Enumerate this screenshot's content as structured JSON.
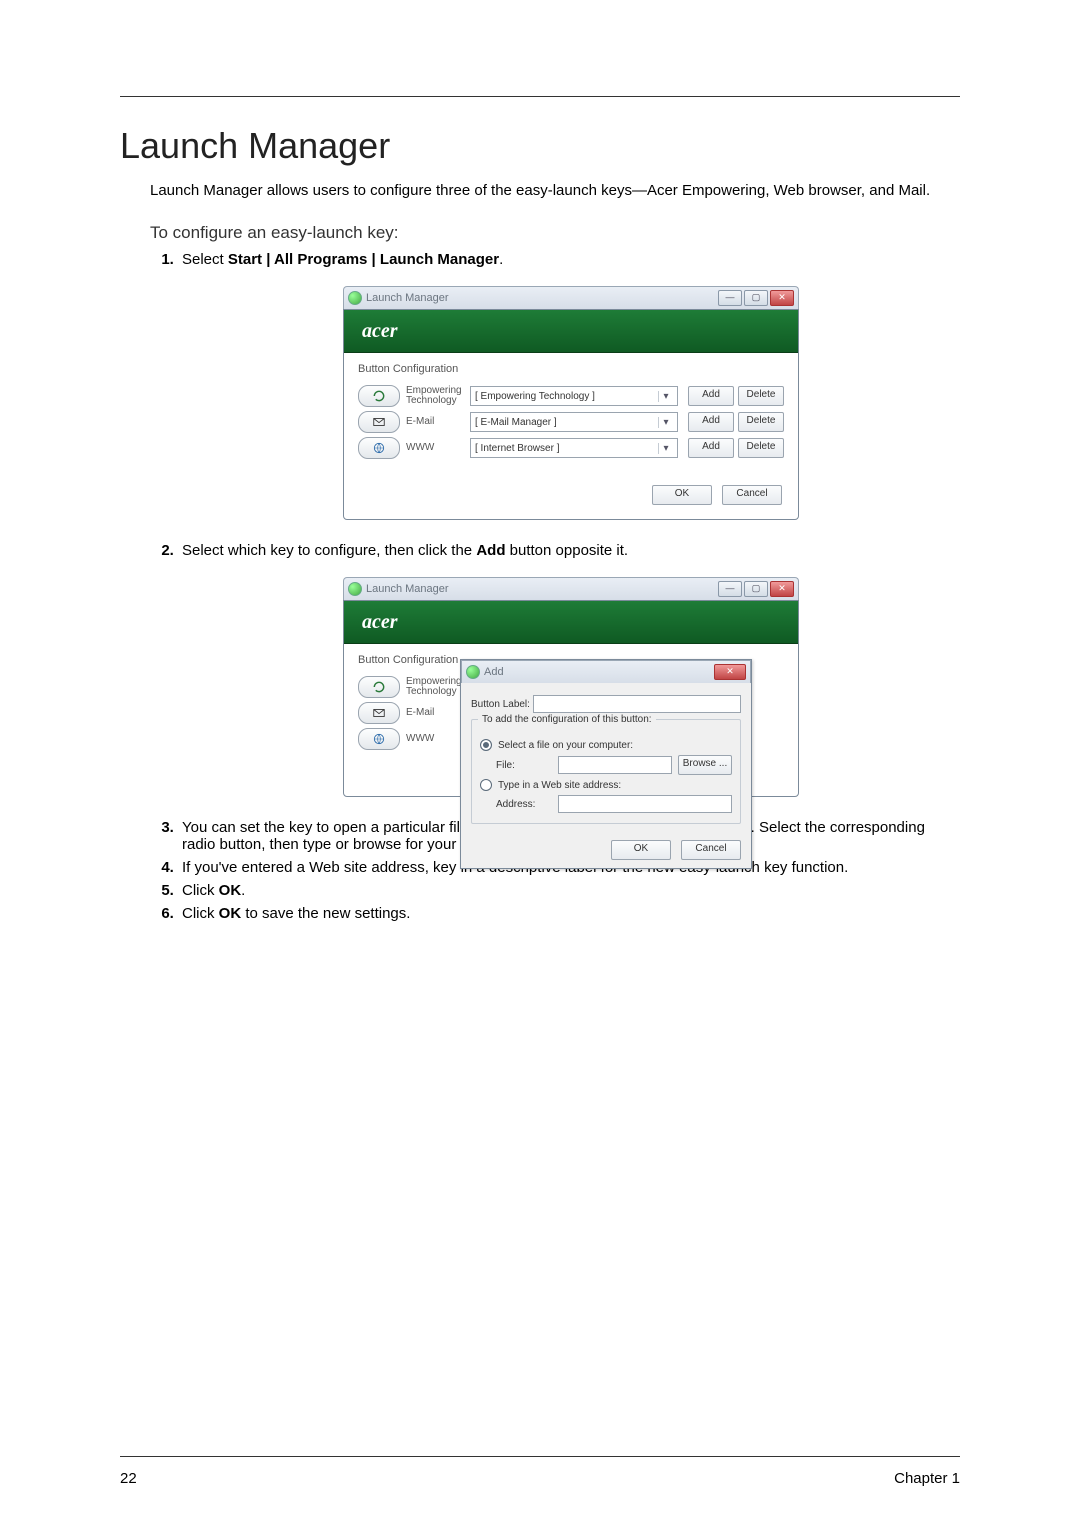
{
  "page": {
    "number": "22",
    "chapter": "Chapter 1",
    "title": "Launch Manager",
    "intro": "Launch Manager allows users to configure three of the easy-launch keys—Acer Empowering, Web browser, and Mail.",
    "subhead": "To configure an easy-launch key:"
  },
  "steps": {
    "s1a": "Select ",
    "s1b": "Start | All Programs | Launch Manager",
    "s1c": ".",
    "s2a": "Select which key to configure, then click the ",
    "s2b": "Add",
    "s2c": " button opposite it.",
    "s3": "You can set the key to open a particular file or program, or display a Web site address. Select the corresponding radio button, then type or browse for your selection.",
    "s4": "If you've entered a Web site address, key in a descriptive label for the new easy-launch key function.",
    "s5a": "Click ",
    "s5b": "OK",
    "s5c": ".",
    "s6a": "Click ",
    "s6b": "OK",
    "s6c": " to save the new settings."
  },
  "win": {
    "title": "Launch Manager",
    "brand": "acer",
    "section": "Button Configuration",
    "rows": [
      {
        "label": "Empowering Technology",
        "keylabel": "Empowering\nTechnology",
        "value": "[ Empowering Technology ]"
      },
      {
        "label": "E-Mail",
        "keylabel": "E-Mail",
        "value": "[ E-Mail Manager ]"
      },
      {
        "label": "WWW",
        "keylabel": "WWW",
        "value": "[ Internet Browser ]"
      }
    ],
    "add": "Add",
    "delete": "Delete",
    "ok": "OK",
    "cancel": "Cancel"
  },
  "adddlg": {
    "title": "Add",
    "button_label_lbl": "Button Label:",
    "group_title": "To add the configuration of this button:",
    "radio_file": "Select a file on your computer:",
    "file_lbl": "File:",
    "browse": "Browse ...",
    "radio_web": "Type in a Web site address:",
    "addr_lbl": "Address:",
    "ok": "OK",
    "cancel": "Cancel"
  }
}
